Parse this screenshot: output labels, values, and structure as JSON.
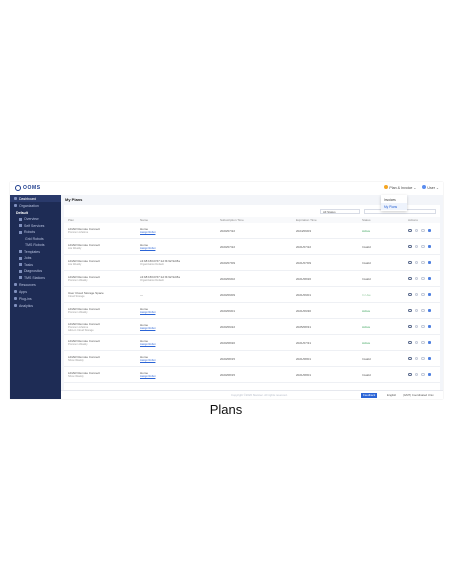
{
  "app": {
    "logo_text": "OOMS",
    "brand_color": "#1a3a8c"
  },
  "topbar": {
    "plans_menu": "Plan & Invoice",
    "user": "User"
  },
  "dropdown": {
    "items": [
      "Invoices",
      "My Plans"
    ]
  },
  "sidebar": {
    "items": [
      {
        "label": "Dashboard"
      },
      {
        "label": "Organization"
      }
    ],
    "default_label": "Default",
    "sub_items": [
      "Overview",
      "Self Services",
      "Robots"
    ],
    "robots_sub": [
      "Grid Robots",
      "TMS Robots"
    ],
    "more_sub": [
      "Templates",
      "Jobs",
      "Tasks",
      "Diagnostics",
      "TMS Stations"
    ],
    "bottom_items": [
      "Resources",
      "Apps",
      "Plug-ins",
      "Analytics"
    ]
  },
  "main": {
    "page_title": "My Plans",
    "filter_label": "All Status",
    "columns": [
      "Plan",
      "Name",
      "Subscription Time",
      "Expiration Time",
      "Status",
      "Actions"
    ],
    "rows": [
      {
        "plan": "LiDAR Remote Connect",
        "plan2": "Premium Lifetime",
        "name": "Home",
        "link": "Assign Robot",
        "sub": "2020/07/22",
        "exp": "2024/09/03",
        "status": "Active",
        "cls": "st-active"
      },
      {
        "plan": "LiDAR Remote Connect",
        "plan2": "Lite Weekly",
        "name": "Home",
        "link": "Assign Robot",
        "sub": "2020/07/22",
        "exp": "2021/07/22",
        "status": "Invalid",
        "cls": "st-invalid"
      },
      {
        "plan": "LiDAR Remote Connect",
        "plan2": "Lite Weekly",
        "name": "c4:b8:b8:b0:57:1d:f4:92:9d:8a",
        "link2": "Organization Default",
        "sub": "2020/07/09",
        "exp": "2021/07/09",
        "status": "Invalid",
        "cls": "st-invalid"
      },
      {
        "plan": "LiDAR Remote Connect",
        "plan2": "Premium Weekly",
        "name": "c4:b8:b8:b0:57:1d:f4:92:9d:8a",
        "link2": "Organization Default",
        "sub": "2020/09/02",
        "exp": "2021/08/26",
        "status": "Invalid",
        "cls": "st-invalid"
      },
      {
        "plan": "User Cloud Storage Space",
        "plan2": "Cloud Storage",
        "name": "—",
        "sub": "2020/09/09",
        "exp": "2021/09/01",
        "status": "In Use",
        "cls": "st-inuse"
      },
      {
        "plan": "LiDAR Remote Connect",
        "plan2": "Premium Weekly",
        "name": "Home",
        "link": "Assign Robot",
        "sub": "2020/09/01",
        "exp": "2021/09/30",
        "status": "Active",
        "cls": "st-active"
      },
      {
        "plan": "LiDAR Remote Connect",
        "plan2": "Premium Lifetime",
        "plan3": "Add-on Cloud Storage",
        "name": "Home",
        "link": "Assign Robot",
        "sub": "2020/09/22",
        "exp": "2025/08/31",
        "status": "Active",
        "cls": "st-active"
      },
      {
        "plan": "LiDAR Remote Connect",
        "plan2": "Premium Weekly",
        "name": "Home",
        "link": "Assign Robot",
        "sub": "2020/08/20",
        "exp": "2021/07/31",
        "status": "Active",
        "cls": "st-active"
      },
      {
        "plan": "LiDAR Remote Connect",
        "plan2": "Show Weekly",
        "name": "Home",
        "link": "Assign Robot",
        "sub": "2020/08/15",
        "exp": "2021/08/01",
        "status": "Invalid",
        "cls": "st-invalid"
      },
      {
        "plan": "LiDAR Remote Connect",
        "plan2": "Show Weekly",
        "name": "Home",
        "link": "Assign Robot",
        "sub": "2020/08/15",
        "exp": "2021/08/01",
        "status": "Invalid",
        "cls": "st-invalid"
      }
    ]
  },
  "footer": {
    "copyright": "Copyright ©2020 Slamtec. All rights reserved.",
    "feedback": "Feedback",
    "language": "English",
    "timezone": "(GMT) Coordinated Univ."
  },
  "caption": "Plans"
}
